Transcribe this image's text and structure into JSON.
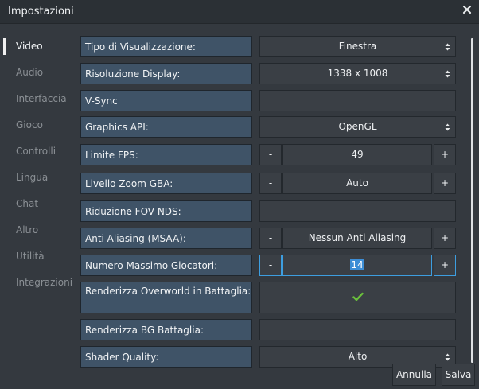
{
  "window": {
    "title": "Impostazioni"
  },
  "sidebar": {
    "items": [
      {
        "label": "Video"
      },
      {
        "label": "Audio"
      },
      {
        "label": "Interfaccia"
      },
      {
        "label": "Gioco"
      },
      {
        "label": "Controlli"
      },
      {
        "label": "Lingua"
      },
      {
        "label": "Chat"
      },
      {
        "label": "Altro"
      },
      {
        "label": "Utilità"
      },
      {
        "label": "Integrazioni"
      }
    ],
    "active": "Video"
  },
  "settings": {
    "display_type": {
      "label": "Tipo di Visualizzazione:",
      "value": "Finestra"
    },
    "resolution": {
      "label": "Risoluzione Display:",
      "value": "1338 x 1008"
    },
    "vsync": {
      "label": "V-Sync"
    },
    "graphics_api": {
      "label": "Graphics API:",
      "value": "OpenGL"
    },
    "fps_limit": {
      "label": "Limite FPS:",
      "value": "49",
      "minus": "-",
      "plus": "+"
    },
    "gba_zoom": {
      "label": "Livello Zoom GBA:",
      "value": "Auto",
      "minus": "-",
      "plus": "+"
    },
    "nds_fov": {
      "label": "Riduzione FOV NDS:"
    },
    "anti_aliasing": {
      "label": "Anti Aliasing (MSAA):",
      "value": "Nessun Anti Aliasing",
      "minus": "-",
      "plus": "+"
    },
    "max_players": {
      "label": "Numero Massimo Giocatori:",
      "value": "14",
      "minus": "-",
      "plus": "+"
    },
    "overworld_battle": {
      "label": "Renderizza Overworld in Battaglia:",
      "checked": true
    },
    "battle_bg": {
      "label": "Renderizza BG Battaglia:"
    },
    "shader_quality": {
      "label": "Shader Quality:",
      "value": "Alto"
    }
  },
  "footer": {
    "cancel_label": "Annulla",
    "save_label": "Salva"
  },
  "colors": {
    "accent": "#3d9ee0",
    "label_bg": "#3f5367",
    "check": "#6abf3c"
  }
}
